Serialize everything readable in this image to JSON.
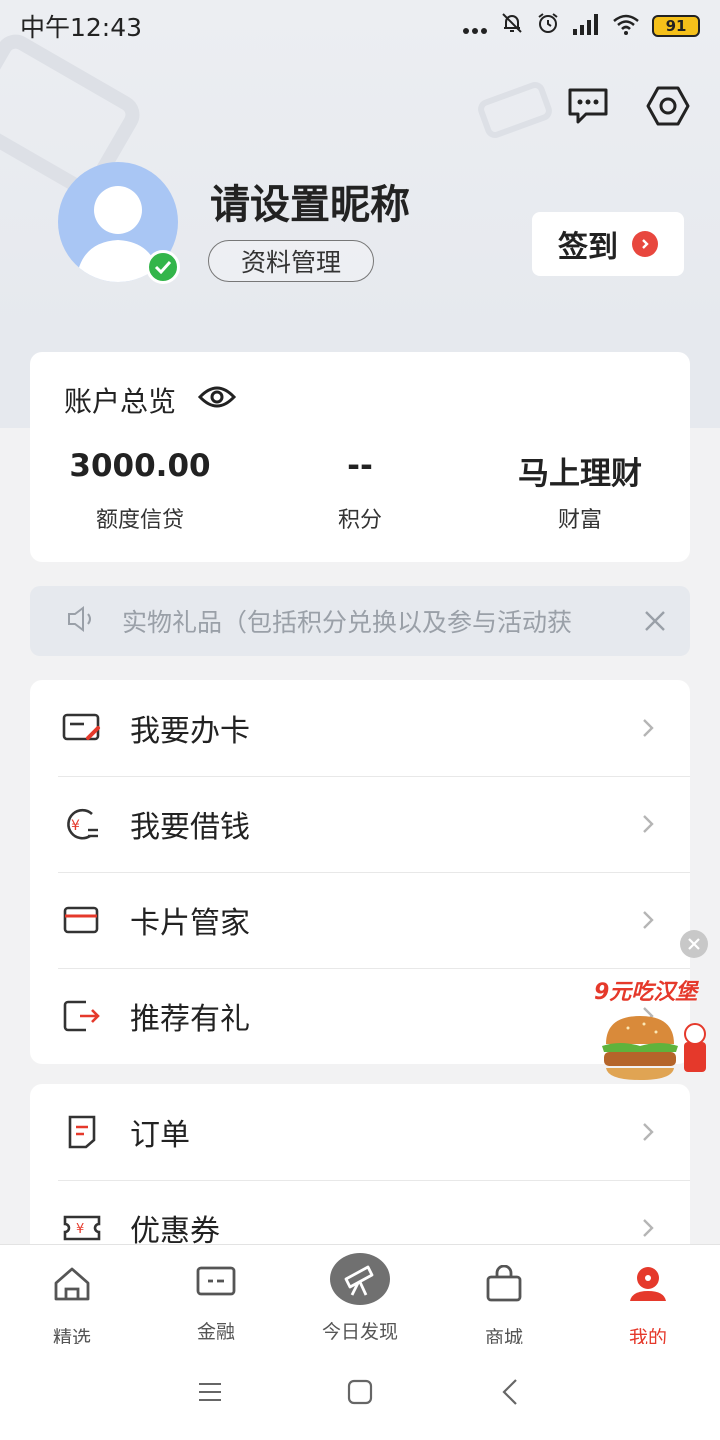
{
  "status_bar": {
    "time": "中午12:43",
    "battery": "91"
  },
  "profile": {
    "nickname": "请设置昵称",
    "manage_label": "资料管理",
    "signin_label": "签到"
  },
  "overview": {
    "title": "账户总览",
    "items": [
      {
        "value": "3000.00",
        "label": "额度信贷"
      },
      {
        "value": "--",
        "label": "积分"
      },
      {
        "value": "马上理财",
        "label": "财富"
      }
    ]
  },
  "notice": {
    "text": "实物礼品（包括积分兑换以及参与活动获"
  },
  "menu_primary": [
    {
      "label": "我要办卡",
      "icon": "card-apply-icon"
    },
    {
      "label": "我要借钱",
      "icon": "loan-icon"
    },
    {
      "label": "卡片管家",
      "icon": "card-manager-icon"
    },
    {
      "label": "推荐有礼",
      "icon": "share-icon"
    }
  ],
  "menu_secondary": [
    {
      "label": "订单",
      "icon": "order-icon"
    },
    {
      "label": "优惠券",
      "icon": "coupon-icon"
    }
  ],
  "ad": {
    "text": "9元吃汉堡"
  },
  "tabs": [
    {
      "label": "精选",
      "icon": "home-icon"
    },
    {
      "label": "金融",
      "icon": "finance-icon"
    },
    {
      "label": "今日发现",
      "icon": "telescope-icon"
    },
    {
      "label": "商城",
      "icon": "shop-icon"
    },
    {
      "label": "我的",
      "icon": "profile-icon",
      "active": true
    }
  ],
  "colors": {
    "accent": "#e5392b",
    "verified": "#33b54a",
    "avatar_bg": "#a9c6f4"
  }
}
